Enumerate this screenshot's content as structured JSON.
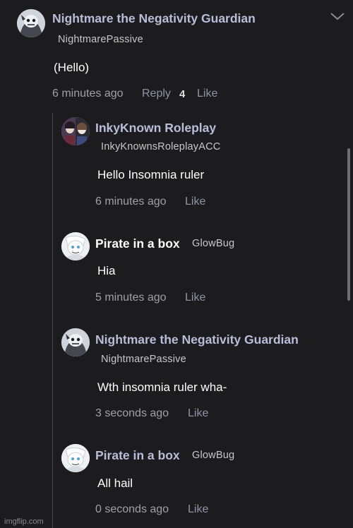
{
  "top_comment": {
    "author": "Nightmare the Negativity Guardian",
    "handle": "NightmarePassive",
    "text": "(Hello)",
    "time": "6 minutes ago",
    "reply_label": "Reply",
    "reply_count": "4",
    "like_label": "Like"
  },
  "replies": [
    {
      "author": "InkyKnown Roleplay",
      "handle": "InkyKnownsRoleplayACC",
      "text": "Hello Insomnia ruler",
      "time": "6 minutes ago",
      "like_label": "Like"
    },
    {
      "author": "Pirate in a box",
      "handle": "GlowBug",
      "text": "Hia",
      "time": "5 minutes ago",
      "like_label": "Like"
    },
    {
      "author": "Nightmare the Negativity Guardian",
      "handle": "NightmarePassive",
      "text": "Wth insomnia ruler wha-",
      "time": "3 seconds ago",
      "like_label": "Like"
    },
    {
      "author": "Pirate in a box",
      "handle": "GlowBug",
      "text": "All hail",
      "time": "0 seconds ago",
      "like_label": "Like"
    }
  ],
  "watermark": "imgflip.com",
  "colors": {
    "background": "#1c1c1e",
    "author_name": "#b9bdd8",
    "link": "#8f93a6"
  }
}
